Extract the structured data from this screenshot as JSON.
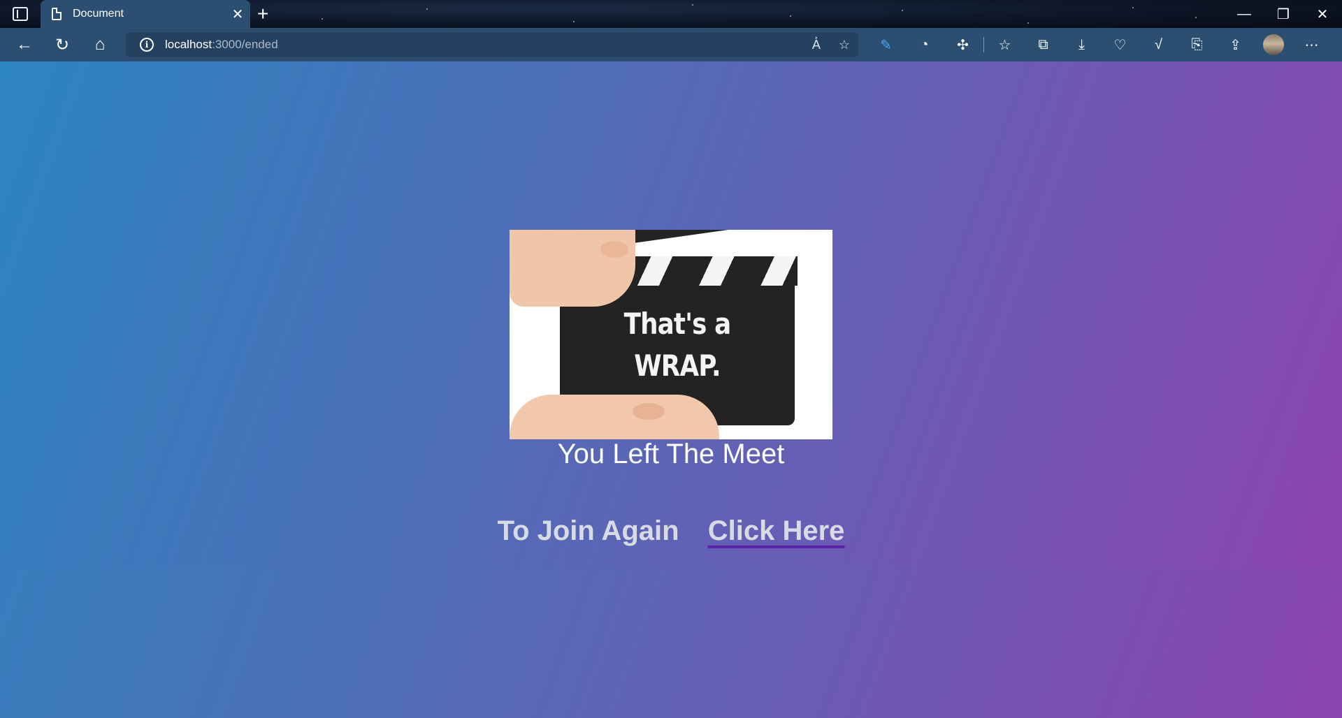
{
  "browser": {
    "tab_title": "Document",
    "tab_close": "✕",
    "new_tab": "+",
    "url_host": "localhost",
    "url_path": ":3000/ended",
    "window_controls": [
      "—",
      "❐",
      "✕"
    ],
    "nav": {
      "back_icon": "arrow-left-icon",
      "refresh_icon": "refresh-icon",
      "home_icon": "home-icon"
    }
  },
  "page": {
    "image": {
      "line1": "That's a",
      "line2": "WRAP."
    },
    "title": "You Left The Meet",
    "rejoin_text": "To Join Again",
    "rejoin_link": "Click Here"
  },
  "colors": {
    "gradient_start": "#2c85c0",
    "gradient_end": "#8d45b0",
    "link_underline": "#5b1fa8",
    "chrome": "#2c4e71"
  }
}
